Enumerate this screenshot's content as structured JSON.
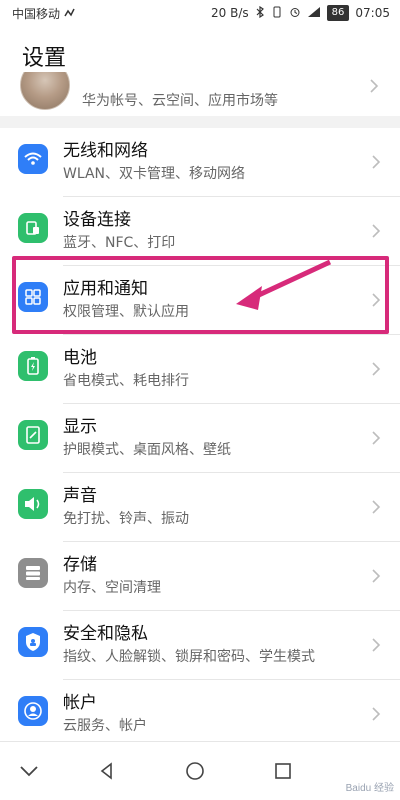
{
  "status": {
    "carrier": "中国移动",
    "net_speed": "20 B/s",
    "battery": "86",
    "time": "07:05"
  },
  "page_title": "设置",
  "profile": {
    "subtitle": "华为帐号、云空间、应用市场等"
  },
  "items": [
    {
      "title": "无线和网络",
      "subtitle": "WLAN、双卡管理、移动网络",
      "icon": "wifi-icon",
      "color": "#2f7ef7"
    },
    {
      "title": "设备连接",
      "subtitle": "蓝牙、NFC、打印",
      "icon": "device-connection-icon",
      "color": "#2fbf6d"
    },
    {
      "title": "应用和通知",
      "subtitle": "权限管理、默认应用",
      "icon": "apps-grid-icon",
      "color": "#2f7ef7"
    },
    {
      "title": "电池",
      "subtitle": "省电模式、耗电排行",
      "icon": "battery-icon",
      "color": "#2fbf6d"
    },
    {
      "title": "显示",
      "subtitle": "护眼模式、桌面风格、壁纸",
      "icon": "display-icon",
      "color": "#2fbf6d"
    },
    {
      "title": "声音",
      "subtitle": "免打扰、铃声、振动",
      "icon": "speaker-icon",
      "color": "#2fbf6d"
    },
    {
      "title": "存储",
      "subtitle": "内存、空间清理",
      "icon": "storage-icon",
      "color": "#8e8e8e"
    },
    {
      "title": "安全和隐私",
      "subtitle": "指纹、人脸解锁、锁屏和密码、学生模式",
      "icon": "shield-icon",
      "color": "#2f7ef7"
    },
    {
      "title": "帐户",
      "subtitle": "云服务、帐户",
      "icon": "account-icon",
      "color": "#2f7ef7"
    }
  ],
  "annotation_color": "#d72a7a",
  "watermark": "Baidu 经验"
}
